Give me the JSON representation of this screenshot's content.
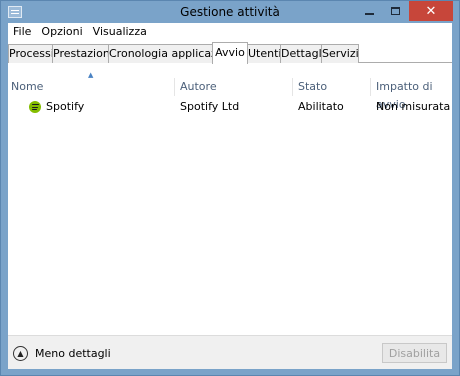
{
  "window": {
    "title": "Gestione attività",
    "icon": "task-manager-icon",
    "controls": {
      "minimize": "minimize-icon",
      "maximize": "maximize-icon",
      "close": "✕"
    }
  },
  "menu": [
    "File",
    "Opzioni",
    "Visualizza"
  ],
  "tabs": [
    "Processi",
    "Prestazioni",
    "Cronologia applicazioni",
    "Avvio",
    "Utenti",
    "Dettagli",
    "Servizi"
  ],
  "active_tab": "Avvio",
  "table": {
    "sort_indicator": "▲",
    "columns": [
      "Nome",
      "Autore",
      "Stato",
      "Impatto di avvio"
    ],
    "rows": [
      {
        "icon": "spotify-icon",
        "name": "Spotify",
        "author": "Spotify Ltd",
        "status": "Abilitato",
        "impact": "Non misurata",
        "icon_color": "#84bd00"
      }
    ]
  },
  "footer": {
    "less_details_icon": "▲",
    "less_details": "Meno dettagli",
    "disable_button": "Disabilita"
  },
  "colors": {
    "title_bar": "#7aa3c9",
    "close_button": "#c7463a",
    "header_text": "#4c607a"
  }
}
